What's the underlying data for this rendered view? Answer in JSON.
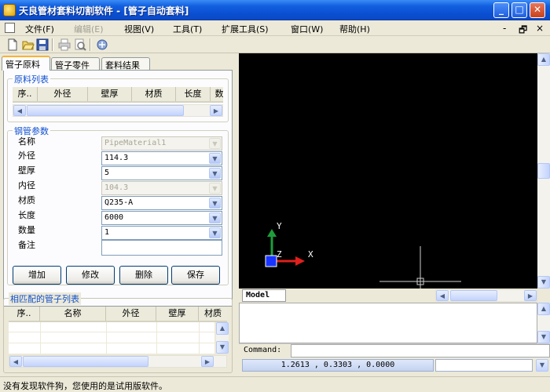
{
  "window": {
    "title": "天良管材套料切割软件 - [管子自动套料]",
    "minimize": "_",
    "maximize": "□",
    "close": "✕"
  },
  "menu": {
    "items": [
      {
        "label": "文件(F)",
        "enabled": true
      },
      {
        "label": "编辑(E)",
        "enabled": false
      },
      {
        "label": "视图(V)",
        "enabled": true
      },
      {
        "label": "工具(T)",
        "enabled": true
      },
      {
        "label": "扩展工具(S)",
        "enabled": true
      },
      {
        "label": "窗口(W)",
        "enabled": true
      },
      {
        "label": "帮助(H)",
        "enabled": true
      }
    ],
    "mdi_minimize": "-",
    "mdi_restore": "🗗",
    "mdi_close": "×"
  },
  "toolbar": {
    "icons": [
      "new-file-icon",
      "open-folder-icon",
      "save-icon",
      "print-icon",
      "print-preview-icon",
      "about-icon"
    ]
  },
  "tabs": [
    "管子原料",
    "管子零件",
    "套料结果"
  ],
  "raw_material": {
    "group_title": "原料列表",
    "columns": [
      "序..",
      "外径",
      "壁厚",
      "材质",
      "长度",
      "数"
    ]
  },
  "pipe_params": {
    "group_title": "钢管参数",
    "fields": [
      {
        "label": "名称",
        "value": "PipeMaterial1",
        "disabled": true
      },
      {
        "label": "外径",
        "value": "114.3",
        "disabled": false
      },
      {
        "label": "壁厚",
        "value": "5",
        "disabled": false
      },
      {
        "label": "内径",
        "value": "104.3",
        "disabled": true
      },
      {
        "label": "材质",
        "value": "Q235-A",
        "disabled": false
      },
      {
        "label": "长度",
        "value": "6000",
        "disabled": false
      },
      {
        "label": "数量",
        "value": "1",
        "disabled": false
      }
    ],
    "note_label": "备注",
    "note_value": ""
  },
  "buttons": {
    "add": "增加",
    "modify": "修改",
    "delete": "删除",
    "save": "保存"
  },
  "matched_parts": {
    "group_title": "相匹配的管子列表",
    "columns": [
      "序..",
      "名称",
      "外径",
      "壁厚",
      "材质"
    ]
  },
  "cad": {
    "axis_x": "X",
    "axis_y": "Y",
    "axis_z": "Z",
    "model_tab": "Model",
    "command_label": "Command:",
    "coordinates": "1.2613 , 0.3303 , 0.0000",
    "colors": {
      "background": "#000000",
      "x_axis": "#e0201c",
      "y_axis": "#1e9e3a",
      "ucs_box": "#1a34ff"
    }
  },
  "status": {
    "text": "没有发现软件狗，您使用的是试用版软件。"
  }
}
